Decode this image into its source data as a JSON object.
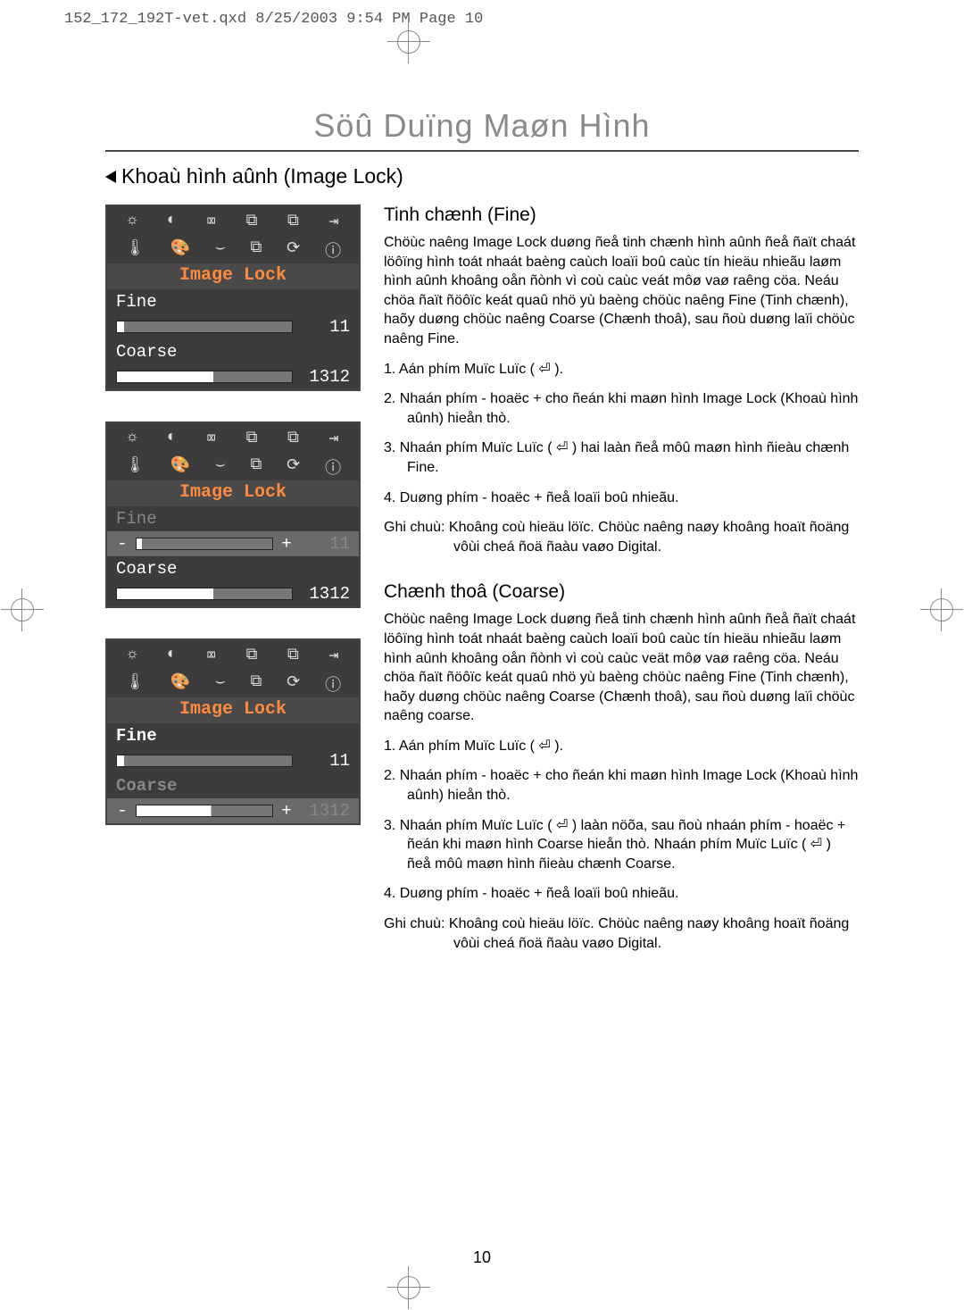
{
  "header": "152_172_192T-vet.qxd  8/25/2003  9:54 PM  Page 10",
  "main_title": "Söû Duïng Maøn Hình",
  "section_title": "Khoaù hình aûnh (Image Lock)",
  "page_number": "10",
  "osd": {
    "label": "Image Lock",
    "fine_label": "Fine",
    "coarse_label": "Coarse",
    "fine_value": "11",
    "coarse_value": "1312",
    "minus": "-",
    "plus": "+",
    "icons_row1": [
      "☼",
      "◐",
      "⌧",
      "⧉",
      "⧉",
      "⇥"
    ],
    "icons_row2": [
      "🌡",
      "🎨",
      "⌣",
      "⧉",
      "⟳",
      "ⓘ"
    ]
  },
  "fine": {
    "title": "Tinh chænh (Fine)",
    "para": "Chöùc naêng Image Lock duøng ñeå tinh chænh hình aûnh ñeå ñaït chaát löôïng hình toát nhaát baèng caùch loaïi boû caùc tín hieäu nhieãu laøm hình aûnh khoâng oån ñònh vì coù caùc veát môø vaø raêng cöa. Neáu chöa ñaït ñöôïc keát quaû nhö yù baèng chöùc naêng Fine (Tinh chænh), haõy duøng chöùc naêng Coarse (Chænh thoâ), sau ñoù duøng laïi chöùc naêng Fine.",
    "steps": [
      "1.  Aán phím Muïc Luïc ( ⏎ ).",
      "2.  Nhaán phím - hoaëc + cho ñeán khi maøn hình Image Lock (Khoaù hình aûnh) hieån thò.",
      "3.  Nhaán phím Muïc Luïc ( ⏎ ) hai laàn ñeå môû maøn hình ñieàu chænh Fine.",
      "4.  Duøng phím - hoaëc + ñeå loaïi boû nhieãu."
    ],
    "note": "Ghi chuù: Khoâng coù hieäu löïc. Chöùc naêng naøy khoâng hoaït ñoäng vôùi cheá ñoä ñaàu vaøo Digital."
  },
  "coarse": {
    "title": "Chænh thoâ (Coarse)",
    "para": "Chöùc naêng Image Lock duøng ñeå tinh chænh hình aûnh ñeå ñaït chaát löôïng hình toát nhaát baèng caùch loaïi boû caùc tín hieäu nhieãu laøm hình aûnh khoâng oån ñònh vì coù caùc veät môø vaø raêng cöa. Neáu chöa ñaït ñöôïc keát quaû nhö yù baèng chöùc naêng Fine (Tinh chænh), haõy duøng chöùc naêng Coarse (Chænh thoâ), sau ñoù duøng laïi chöùc naêng coarse.",
    "steps": [
      "1.  Aán phím Muïc Luïc ( ⏎ ).",
      "2.  Nhaán phím - hoaëc + cho ñeán khi maøn hình Image Lock (Khoaù hình aûnh) hieån thò.",
      "3.  Nhaán phím Muïc Luïc ( ⏎ ) laàn nöõa, sau ñoù nhaán phím - hoaëc + ñeán khi maøn hình Coarse hieån thò. Nhaán phím Muïc Luïc ( ⏎ ) ñeå môû maøn hình ñieàu chænh Coarse.",
      "4.  Duøng phím - hoaëc + ñeå loaïi boû nhieãu."
    ],
    "note": "Ghi chuù: Khoâng coù hieäu löïc. Chöùc naêng naøy khoâng hoaït ñoäng vôùi cheá ñoä ñaàu vaøo Digital."
  }
}
